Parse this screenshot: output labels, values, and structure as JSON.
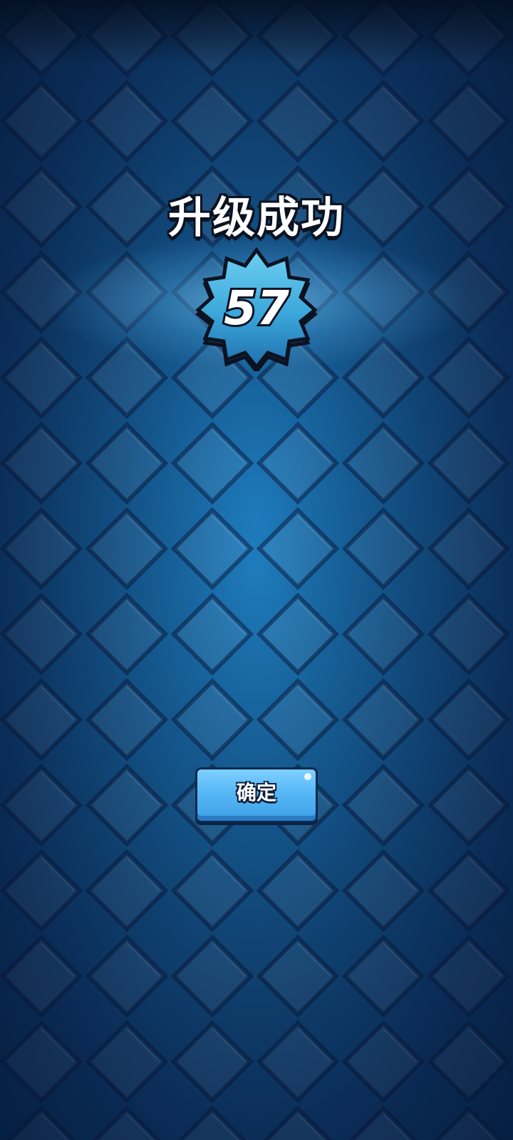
{
  "levelup": {
    "title": "升级成功",
    "level": "57",
    "confirm_label": "确定"
  },
  "colors": {
    "background": "#17629f",
    "badge_fill": "#3aa7da",
    "button_fill": "#56b8f6",
    "outline": "#0b1220"
  },
  "icons": {
    "badge": "level-star-badge-icon"
  }
}
